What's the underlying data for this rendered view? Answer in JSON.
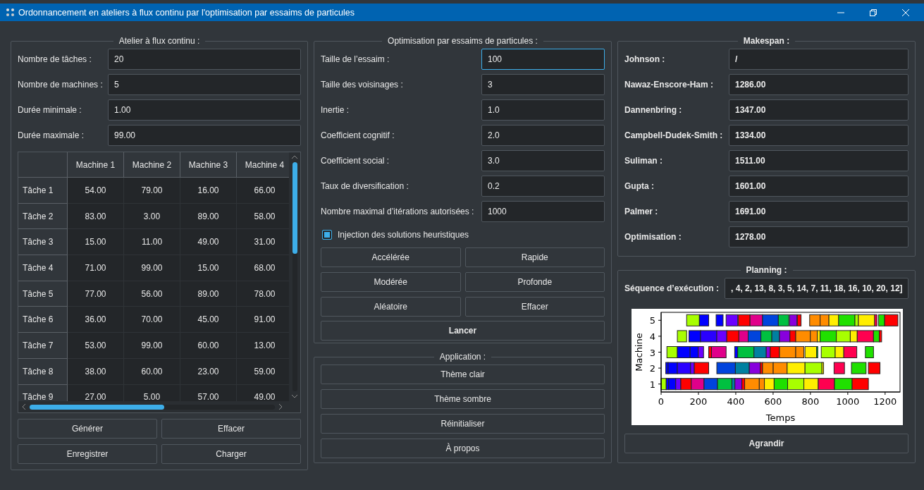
{
  "window": {
    "title": "Ordonnancement en ateliers à flux continu par l'optimisation par essaims de particules"
  },
  "workshop": {
    "title": "Atelier à flux continu :",
    "fields": [
      {
        "label": "Nombre de tâches :",
        "value": "20"
      },
      {
        "label": "Nombre de machines :",
        "value": "5"
      },
      {
        "label": "Durée minimale :",
        "value": "1.00"
      },
      {
        "label": "Durée maximale :",
        "value": "99.00"
      }
    ],
    "table": {
      "columns": [
        "Machine 1",
        "Machine 2",
        "Machine 3",
        "Machine 4"
      ],
      "rows": [
        {
          "header": "Tâche 1",
          "cells": [
            "54.00",
            "79.00",
            "16.00",
            "66.00"
          ]
        },
        {
          "header": "Tâche 2",
          "cells": [
            "83.00",
            "3.00",
            "89.00",
            "58.00"
          ]
        },
        {
          "header": "Tâche 3",
          "cells": [
            "15.00",
            "11.00",
            "49.00",
            "31.00"
          ]
        },
        {
          "header": "Tâche 4",
          "cells": [
            "71.00",
            "99.00",
            "15.00",
            "68.00"
          ]
        },
        {
          "header": "Tâche 5",
          "cells": [
            "77.00",
            "56.00",
            "89.00",
            "78.00"
          ]
        },
        {
          "header": "Tâche 6",
          "cells": [
            "36.00",
            "70.00",
            "45.00",
            "91.00"
          ]
        },
        {
          "header": "Tâche 7",
          "cells": [
            "53.00",
            "99.00",
            "60.00",
            "13.00"
          ]
        },
        {
          "header": "Tâche 8",
          "cells": [
            "38.00",
            "60.00",
            "23.00",
            "59.00"
          ]
        },
        {
          "header": "Tâche 9",
          "cells": [
            "27.00",
            "5.00",
            "57.00",
            "49.00"
          ]
        }
      ]
    },
    "buttons": [
      "Générer",
      "Effacer",
      "Enregistrer",
      "Charger"
    ]
  },
  "pso": {
    "title": "Optimisation par essaims de particules :",
    "fields": [
      {
        "label": "Taille de l’essaim :",
        "value": "100",
        "focused": true
      },
      {
        "label": "Taille des voisinages :",
        "value": "3",
        "focused": false
      },
      {
        "label": "Inertie :",
        "value": "1.0",
        "focused": false
      },
      {
        "label": "Coefficient cognitif :",
        "value": "2.0",
        "focused": false
      },
      {
        "label": "Coefficient social :",
        "value": "3.0",
        "focused": false
      },
      {
        "label": "Taux de diversification :",
        "value": "0.2",
        "focused": false
      },
      {
        "label": "Nombre maximal d’itérations autorisées :",
        "value": "1000",
        "focused": false
      }
    ],
    "checkbox": {
      "label": "Injection des solutions heuristiques",
      "checked": true
    },
    "buttons": [
      "Accélérée",
      "Rapide",
      "Modérée",
      "Profonde",
      "Aléatoire",
      "Effacer"
    ],
    "launch_button": "Lancer"
  },
  "application": {
    "title": "Application :",
    "buttons": [
      "Thème clair",
      "Thème sombre",
      "Réinitialiser",
      "À propos"
    ]
  },
  "makespan": {
    "title": "Makespan :",
    "fields": [
      {
        "label": "Johnson :",
        "value": "/"
      },
      {
        "label": "Nawaz-Enscore-Ham :",
        "value": "1286.00"
      },
      {
        "label": "Dannenbring :",
        "value": "1347.00"
      },
      {
        "label": "Campbell-Dudek-Smith :",
        "value": "1334.00"
      },
      {
        "label": "Suliman :",
        "value": "1511.00"
      },
      {
        "label": "Gupta :",
        "value": "1601.00"
      },
      {
        "label": "Palmer :",
        "value": "1691.00"
      },
      {
        "label": "Optimisation :",
        "value": "1278.00"
      }
    ]
  },
  "planning": {
    "title": "Planning :",
    "sequence": {
      "label": "Séquence d’exécution :",
      "value": ", 4, 2, 13, 8, 3, 5, 14, 7, 11, 18, 16, 10, 20, 12]"
    },
    "gantt": {
      "xlabel": "Temps",
      "ylabel": "Machine",
      "xticks": [
        "0",
        "200",
        "400",
        "600",
        "800",
        "1000",
        "1200"
      ],
      "yticks": [
        "5",
        "4",
        "3",
        "2",
        "1"
      ]
    },
    "button": "Agrandir"
  }
}
